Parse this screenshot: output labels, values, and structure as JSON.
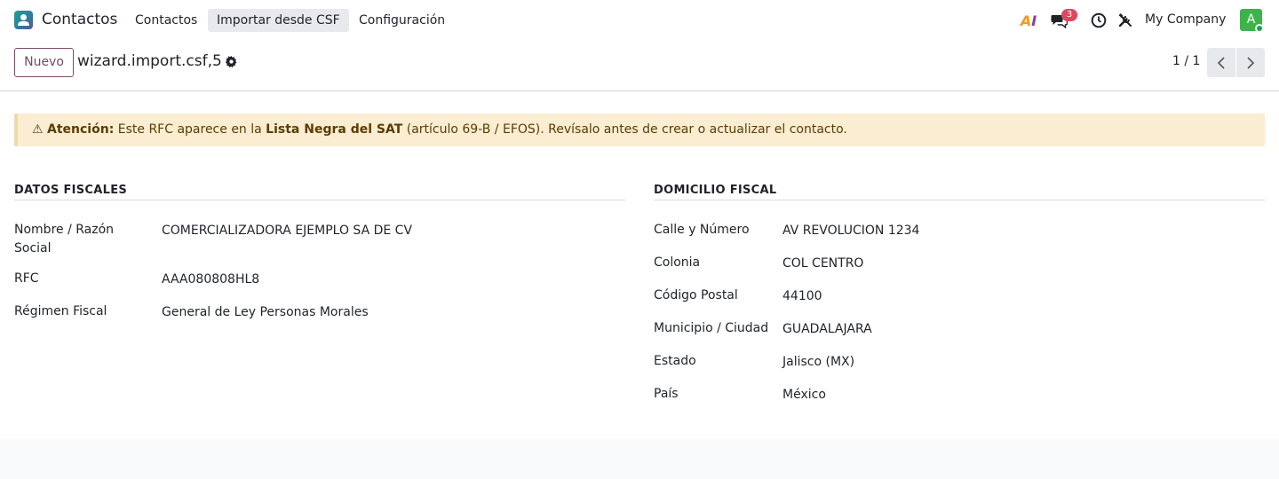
{
  "navbar": {
    "app_name": "Contactos",
    "menu": [
      "Contactos",
      "Importar desde CSF",
      "Configuración"
    ],
    "ai_label_a": "A",
    "ai_label_i": "I",
    "messages_count": "3",
    "company": "My Company",
    "avatar_initial": "A"
  },
  "control_panel": {
    "new_button": "Nuevo",
    "record_title": "wizard.import.csf,5",
    "pager": "1 / 1"
  },
  "alert": {
    "icon": "⚠",
    "prefix_bold": "Atención:",
    "text_1": " Este RFC aparece en la ",
    "bold_2": "Lista Negra del SAT",
    "text_2": " (artículo 69-B / EFOS). Revísalo antes de crear o actualizar el contacto."
  },
  "datos_fiscales": {
    "title": "DATOS FISCALES",
    "fields": [
      {
        "label": "Nombre / Razón Social",
        "value": "COMERCIALIZADORA EJEMPLO SA DE CV"
      },
      {
        "label": "RFC",
        "value": "AAA080808HL8"
      },
      {
        "label": "Régimen Fiscal",
        "value": "General de Ley Personas Morales"
      }
    ]
  },
  "domicilio_fiscal": {
    "title": "DOMICILIO FISCAL",
    "fields": [
      {
        "label": "Calle y Número",
        "value": "AV REVOLUCION 1234"
      },
      {
        "label": "Colonia",
        "value": "COL CENTRO"
      },
      {
        "label": "Código Postal",
        "value": "44100"
      },
      {
        "label": "Municipio / Ciudad",
        "value": "GUADALAJARA"
      },
      {
        "label": "Estado",
        "value": "Jalisco (MX)"
      },
      {
        "label": "País",
        "value": "México"
      }
    ]
  }
}
